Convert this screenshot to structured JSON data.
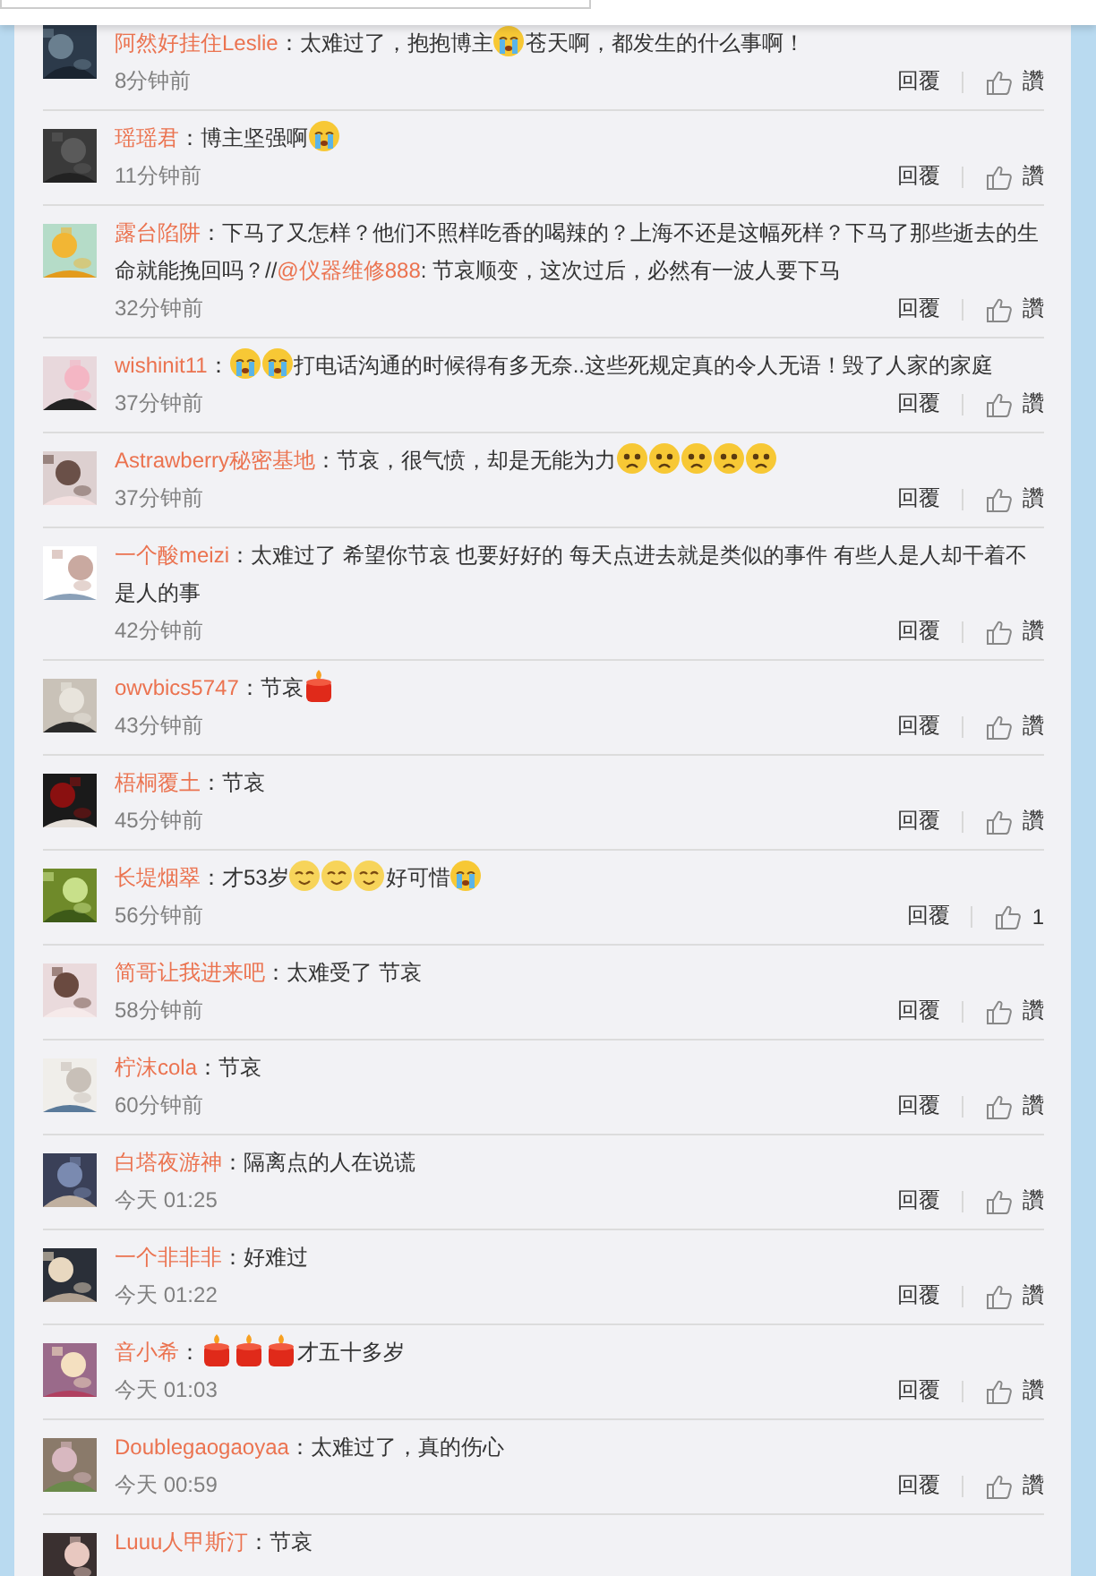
{
  "comments": [
    {
      "user": "阿然好挂住Leslie",
      "parts": [
        {
          "kind": "text",
          "text": "：太难过了，抱抱博主"
        },
        {
          "kind": "cry"
        },
        {
          "kind": "text",
          "text": "苍天啊，都发生的什么事啊！"
        }
      ],
      "time": "8分钟前",
      "reply": "回覆",
      "like": "讚"
    },
    {
      "user": "瑶瑶君",
      "parts": [
        {
          "kind": "text",
          "text": "：博主坚强啊"
        },
        {
          "kind": "cry"
        }
      ],
      "time": "11分钟前",
      "reply": "回覆",
      "like": "讚"
    },
    {
      "user": "露台陷阱",
      "parts": [
        {
          "kind": "text",
          "text": "：下马了又怎样？他们不照样吃香的喝辣的？上海不还是这幅死样？下马了那些逝去的生命就能挽回吗？//"
        },
        {
          "kind": "link",
          "text": "@仪器维修888"
        },
        {
          "kind": "text",
          "text": ": 节哀顺变，这次过后，必然有一波人要下马"
        }
      ],
      "time": "32分钟前",
      "reply": "回覆",
      "like": "讚"
    },
    {
      "user": "wishinit11",
      "parts": [
        {
          "kind": "text",
          "text": "："
        },
        {
          "kind": "cry"
        },
        {
          "kind": "cry"
        },
        {
          "kind": "text",
          "text": "打电话沟通的时候得有多无奈..这些死规定真的令人无语！毁了人家的家庭"
        }
      ],
      "time": "37分钟前",
      "reply": "回覆",
      "like": "讚"
    },
    {
      "user": "Astrawberry秘密基地",
      "parts": [
        {
          "kind": "text",
          "text": "：节哀，很气愤，却是无能为力"
        },
        {
          "kind": "sad"
        },
        {
          "kind": "sad"
        },
        {
          "kind": "sad"
        },
        {
          "kind": "sad"
        },
        {
          "kind": "sad"
        }
      ],
      "time": "37分钟前",
      "reply": "回覆",
      "like": "讚"
    },
    {
      "user": "一个酸meizi",
      "parts": [
        {
          "kind": "text",
          "text": "：太难过了 希望你节哀 也要好好的 每天点进去就是类似的事件 有些人是人却干着不是人的事"
        }
      ],
      "time": "42分钟前",
      "reply": "回覆",
      "like": "讚"
    },
    {
      "user": "owvbics5747",
      "parts": [
        {
          "kind": "text",
          "text": "：节哀"
        },
        {
          "kind": "candle"
        }
      ],
      "time": "43分钟前",
      "reply": "回覆",
      "like": "讚"
    },
    {
      "user": "梧桐覆土",
      "parts": [
        {
          "kind": "text",
          "text": "：节哀"
        }
      ],
      "time": "45分钟前",
      "reply": "回覆",
      "like": "讚"
    },
    {
      "user": "长堤烟翠",
      "parts": [
        {
          "kind": "text",
          "text": "：才53岁"
        },
        {
          "kind": "smile"
        },
        {
          "kind": "smile"
        },
        {
          "kind": "smile"
        },
        {
          "kind": "text",
          "text": "好可惜"
        },
        {
          "kind": "cry"
        }
      ],
      "time": "56分钟前",
      "reply": "回覆",
      "like": "1"
    },
    {
      "user": "简哥让我进来吧",
      "parts": [
        {
          "kind": "text",
          "text": "：太难受了 节哀"
        }
      ],
      "time": "58分钟前",
      "reply": "回覆",
      "like": "讚"
    },
    {
      "user": "柠沫cola",
      "parts": [
        {
          "kind": "text",
          "text": "：节哀"
        }
      ],
      "time": "60分钟前",
      "reply": "回覆",
      "like": "讚"
    },
    {
      "user": "白塔夜游神",
      "parts": [
        {
          "kind": "text",
          "text": "：隔离点的人在说谎"
        }
      ],
      "time": "今天 01:25",
      "reply": "回覆",
      "like": "讚"
    },
    {
      "user": "一个非非非",
      "parts": [
        {
          "kind": "text",
          "text": "：好难过"
        }
      ],
      "time": "今天 01:22",
      "reply": "回覆",
      "like": "讚"
    },
    {
      "user": "音小希",
      "parts": [
        {
          "kind": "text",
          "text": "："
        },
        {
          "kind": "candle"
        },
        {
          "kind": "candle"
        },
        {
          "kind": "candle"
        },
        {
          "kind": "text",
          "text": "才五十多岁"
        }
      ],
      "time": "今天 01:03",
      "reply": "回覆",
      "like": "讚"
    },
    {
      "user": "Doublegaogaoyaa",
      "parts": [
        {
          "kind": "text",
          "text": "：太难过了，真的伤心"
        }
      ],
      "time": "今天 00:59",
      "reply": "回覆",
      "like": "讚"
    },
    {
      "user": "Luuu人甲斯汀",
      "parts": [
        {
          "kind": "text",
          "text": "：节哀"
        }
      ]
    }
  ]
}
